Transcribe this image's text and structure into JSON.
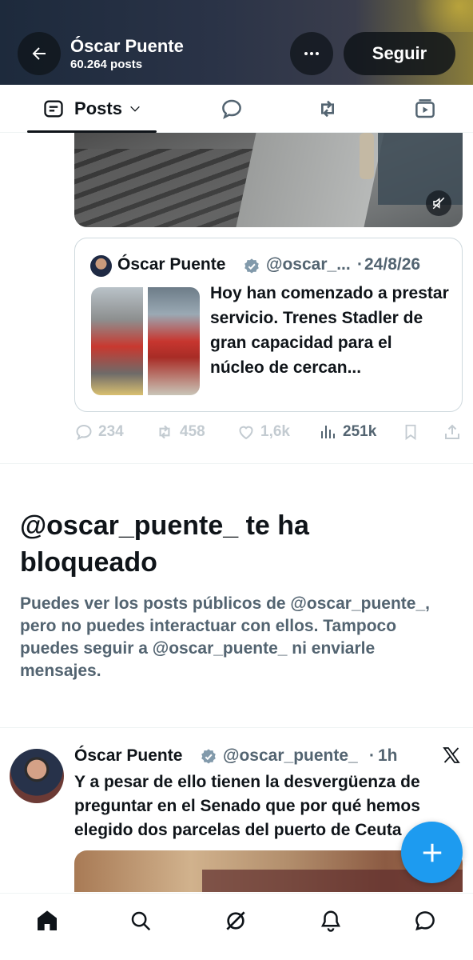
{
  "header": {
    "name": "Óscar Puente",
    "posts_count": "60.264 posts",
    "follow_label": "Seguir",
    "accent_color": "#1d9bf0"
  },
  "tabs": {
    "posts_label": "Posts",
    "icons": [
      "posts-filter-icon",
      "replies-icon",
      "reposts-icon",
      "media-icon"
    ]
  },
  "quoted_post": {
    "name": "Óscar Puente",
    "handle": "@oscar_...",
    "separator": "·",
    "date": "24/8/26",
    "text": "Hoy han comenzado a prestar servicio. Trenes Stadler de gran capacidad para el núcleo de cercan..."
  },
  "post_actions": {
    "replies": "234",
    "reposts": "458",
    "likes": "1,6k",
    "views": "251k"
  },
  "blocked_notice": {
    "title": "@oscar_puente_ te ha bloqueado",
    "description": "Puedes ver los posts públicos de @oscar_puente_, pero no puedes interactuar con ellos. Tampoco puedes seguir a @oscar_puente_ ni enviarle mensajes."
  },
  "post": {
    "name": "Óscar Puente",
    "handle": "@oscar_puente_",
    "separator": "·",
    "time": "1h",
    "text": "Y a pesar de ello tienen la desvergüenza de preguntar en el Senado que por qué hemos elegido dos parcelas del puerto de Ceuta"
  },
  "bottom_nav": [
    "home-icon",
    "search-icon",
    "grok-icon",
    "notifications-icon",
    "messages-icon"
  ]
}
